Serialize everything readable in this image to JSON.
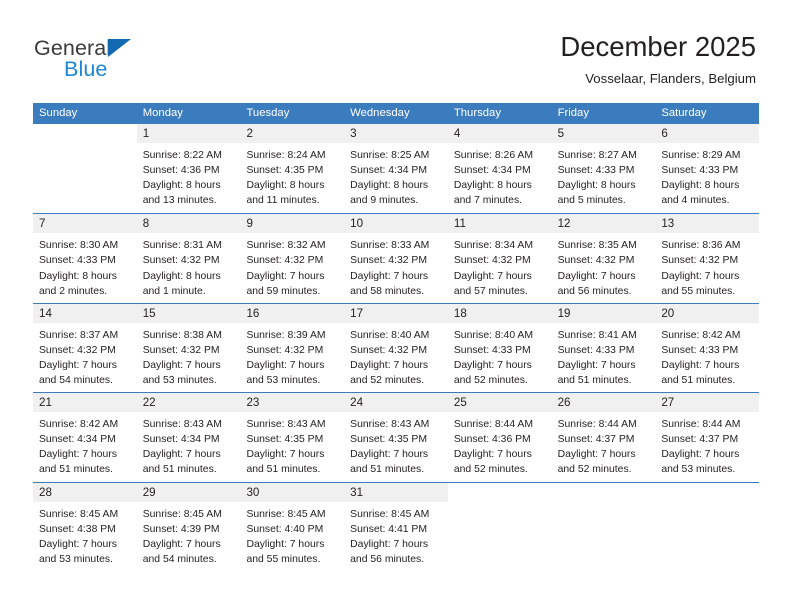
{
  "brand": {
    "name_part1": "General",
    "name_part2": "Blue",
    "triangle_color": "#1269b0",
    "blue_color": "#1d86d4"
  },
  "header": {
    "title": "December 2025",
    "subtitle": "Vosselaar, Flanders, Belgium"
  },
  "theme": {
    "header_bar": "#3b7cbf",
    "daynum_band": "#f0f0f0",
    "text": "#231f20"
  },
  "weekdays": [
    "Sunday",
    "Monday",
    "Tuesday",
    "Wednesday",
    "Thursday",
    "Friday",
    "Saturday"
  ],
  "weeks": [
    [
      {
        "day": "",
        "lines": []
      },
      {
        "day": "1",
        "lines": [
          "Sunrise: 8:22 AM",
          "Sunset: 4:36 PM",
          "Daylight: 8 hours",
          "and 13 minutes."
        ]
      },
      {
        "day": "2",
        "lines": [
          "Sunrise: 8:24 AM",
          "Sunset: 4:35 PM",
          "Daylight: 8 hours",
          "and 11 minutes."
        ]
      },
      {
        "day": "3",
        "lines": [
          "Sunrise: 8:25 AM",
          "Sunset: 4:34 PM",
          "Daylight: 8 hours",
          "and 9 minutes."
        ]
      },
      {
        "day": "4",
        "lines": [
          "Sunrise: 8:26 AM",
          "Sunset: 4:34 PM",
          "Daylight: 8 hours",
          "and 7 minutes."
        ]
      },
      {
        "day": "5",
        "lines": [
          "Sunrise: 8:27 AM",
          "Sunset: 4:33 PM",
          "Daylight: 8 hours",
          "and 5 minutes."
        ]
      },
      {
        "day": "6",
        "lines": [
          "Sunrise: 8:29 AM",
          "Sunset: 4:33 PM",
          "Daylight: 8 hours",
          "and 4 minutes."
        ]
      }
    ],
    [
      {
        "day": "7",
        "lines": [
          "Sunrise: 8:30 AM",
          "Sunset: 4:33 PM",
          "Daylight: 8 hours",
          "and 2 minutes."
        ]
      },
      {
        "day": "8",
        "lines": [
          "Sunrise: 8:31 AM",
          "Sunset: 4:32 PM",
          "Daylight: 8 hours",
          "and 1 minute."
        ]
      },
      {
        "day": "9",
        "lines": [
          "Sunrise: 8:32 AM",
          "Sunset: 4:32 PM",
          "Daylight: 7 hours",
          "and 59 minutes."
        ]
      },
      {
        "day": "10",
        "lines": [
          "Sunrise: 8:33 AM",
          "Sunset: 4:32 PM",
          "Daylight: 7 hours",
          "and 58 minutes."
        ]
      },
      {
        "day": "11",
        "lines": [
          "Sunrise: 8:34 AM",
          "Sunset: 4:32 PM",
          "Daylight: 7 hours",
          "and 57 minutes."
        ]
      },
      {
        "day": "12",
        "lines": [
          "Sunrise: 8:35 AM",
          "Sunset: 4:32 PM",
          "Daylight: 7 hours",
          "and 56 minutes."
        ]
      },
      {
        "day": "13",
        "lines": [
          "Sunrise: 8:36 AM",
          "Sunset: 4:32 PM",
          "Daylight: 7 hours",
          "and 55 minutes."
        ]
      }
    ],
    [
      {
        "day": "14",
        "lines": [
          "Sunrise: 8:37 AM",
          "Sunset: 4:32 PM",
          "Daylight: 7 hours",
          "and 54 minutes."
        ]
      },
      {
        "day": "15",
        "lines": [
          "Sunrise: 8:38 AM",
          "Sunset: 4:32 PM",
          "Daylight: 7 hours",
          "and 53 minutes."
        ]
      },
      {
        "day": "16",
        "lines": [
          "Sunrise: 8:39 AM",
          "Sunset: 4:32 PM",
          "Daylight: 7 hours",
          "and 53 minutes."
        ]
      },
      {
        "day": "17",
        "lines": [
          "Sunrise: 8:40 AM",
          "Sunset: 4:32 PM",
          "Daylight: 7 hours",
          "and 52 minutes."
        ]
      },
      {
        "day": "18",
        "lines": [
          "Sunrise: 8:40 AM",
          "Sunset: 4:33 PM",
          "Daylight: 7 hours",
          "and 52 minutes."
        ]
      },
      {
        "day": "19",
        "lines": [
          "Sunrise: 8:41 AM",
          "Sunset: 4:33 PM",
          "Daylight: 7 hours",
          "and 51 minutes."
        ]
      },
      {
        "day": "20",
        "lines": [
          "Sunrise: 8:42 AM",
          "Sunset: 4:33 PM",
          "Daylight: 7 hours",
          "and 51 minutes."
        ]
      }
    ],
    [
      {
        "day": "21",
        "lines": [
          "Sunrise: 8:42 AM",
          "Sunset: 4:34 PM",
          "Daylight: 7 hours",
          "and 51 minutes."
        ]
      },
      {
        "day": "22",
        "lines": [
          "Sunrise: 8:43 AM",
          "Sunset: 4:34 PM",
          "Daylight: 7 hours",
          "and 51 minutes."
        ]
      },
      {
        "day": "23",
        "lines": [
          "Sunrise: 8:43 AM",
          "Sunset: 4:35 PM",
          "Daylight: 7 hours",
          "and 51 minutes."
        ]
      },
      {
        "day": "24",
        "lines": [
          "Sunrise: 8:43 AM",
          "Sunset: 4:35 PM",
          "Daylight: 7 hours",
          "and 51 minutes."
        ]
      },
      {
        "day": "25",
        "lines": [
          "Sunrise: 8:44 AM",
          "Sunset: 4:36 PM",
          "Daylight: 7 hours",
          "and 52 minutes."
        ]
      },
      {
        "day": "26",
        "lines": [
          "Sunrise: 8:44 AM",
          "Sunset: 4:37 PM",
          "Daylight: 7 hours",
          "and 52 minutes."
        ]
      },
      {
        "day": "27",
        "lines": [
          "Sunrise: 8:44 AM",
          "Sunset: 4:37 PM",
          "Daylight: 7 hours",
          "and 53 minutes."
        ]
      }
    ],
    [
      {
        "day": "28",
        "lines": [
          "Sunrise: 8:45 AM",
          "Sunset: 4:38 PM",
          "Daylight: 7 hours",
          "and 53 minutes."
        ]
      },
      {
        "day": "29",
        "lines": [
          "Sunrise: 8:45 AM",
          "Sunset: 4:39 PM",
          "Daylight: 7 hours",
          "and 54 minutes."
        ]
      },
      {
        "day": "30",
        "lines": [
          "Sunrise: 8:45 AM",
          "Sunset: 4:40 PM",
          "Daylight: 7 hours",
          "and 55 minutes."
        ]
      },
      {
        "day": "31",
        "lines": [
          "Sunrise: 8:45 AM",
          "Sunset: 4:41 PM",
          "Daylight: 7 hours",
          "and 56 minutes."
        ]
      },
      {
        "day": "",
        "lines": []
      },
      {
        "day": "",
        "lines": []
      },
      {
        "day": "",
        "lines": []
      }
    ]
  ]
}
